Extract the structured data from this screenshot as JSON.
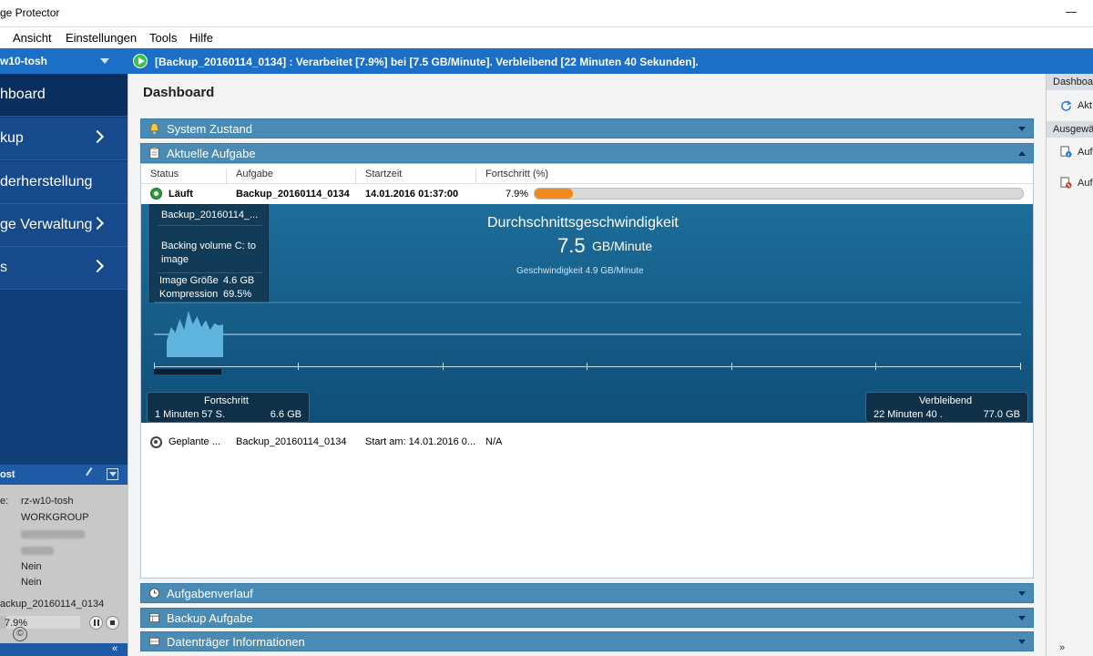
{
  "window": {
    "title": "ge Protector"
  },
  "menu": {
    "items": [
      "Ansicht",
      "Einstellungen",
      "Tools",
      "Hilfe"
    ]
  },
  "statusbar": {
    "machine": "w10-tosh",
    "message": "[Backup_20160114_0134] : Verarbeitet [7.9%] bei [7.5 GB/Minute]. Verbleibend [22 Minuten 40 Sekunden].",
    "color": "#1b6fc6"
  },
  "nav": {
    "items": [
      {
        "label": "hboard"
      },
      {
        "label": "kup"
      },
      {
        "label": "derherstellung"
      },
      {
        "label": "ge Verwaltung"
      },
      {
        "label": "s"
      }
    ]
  },
  "host": {
    "title": "ost",
    "name_label": "e:",
    "name": "rz-w10-tosh",
    "workgroup": "WORKGROUP",
    "row5": "Nein",
    "row6": "Nein",
    "job": "ackup_20160114_0134",
    "progress_pct": "7.9%",
    "progress_value": 0.079
  },
  "main": {
    "page_title": "Dashboard",
    "sections": {
      "system": "System Zustand",
      "current": "Aktuelle Aufgabe",
      "history": "Aufgabenverlauf",
      "backup": "Backup Aufgabe",
      "disk": "Datenträger Informationen"
    },
    "table": {
      "headers": [
        "Status",
        "Aufgabe",
        "Startzeit",
        "Fortschritt (%)"
      ],
      "running": {
        "status": "Läuft",
        "task": "Backup_20160114_0134",
        "start": "14.01.2016 01:37:00",
        "progress_text": "7.9%",
        "progress": 0.079,
        "bar_color": "#f08a1a"
      },
      "scheduled": {
        "status": "Geplante ...",
        "task": "Backup_20160114_0134",
        "start": "Start am: 14.01.2016 0...",
        "progress": "N/A"
      }
    },
    "detail": {
      "tooltip_task": "Backup_20160114_...",
      "tooltip_action_1": "Backing volume C: to",
      "tooltip_action_2": "image",
      "image_size_label": "Image Größe",
      "image_size": "4.6 GB",
      "compression_label": "Kompression",
      "compression": "69.5%",
      "avg_speed_title": "Durchschnittsgeschwindigkeit",
      "avg_speed_value": "7.5",
      "avg_speed_unit": "GB/Minute",
      "speed_sub": "Geschwindigkeit 4.9 GB/Minute",
      "progress_box": {
        "title": "Fortschritt",
        "time": "1 Minuten 57 S.",
        "size": "6.6 GB"
      },
      "remaining_box": {
        "title": "Verbleibend",
        "time": "22 Minuten 40 .",
        "size": "77.0 GB"
      },
      "graph_color": "#5fb4de",
      "speed_samples": [
        0.3,
        0.55,
        0.45,
        0.7,
        0.5,
        0.85,
        0.6,
        0.75,
        0.55,
        0.68,
        0.5,
        0.62,
        0.58,
        0.6
      ]
    }
  },
  "right": {
    "hdr1": "Dashboa",
    "item1": "Akt",
    "hdr2": "Ausgewä",
    "item2": "Auf",
    "item3": "Auf"
  }
}
